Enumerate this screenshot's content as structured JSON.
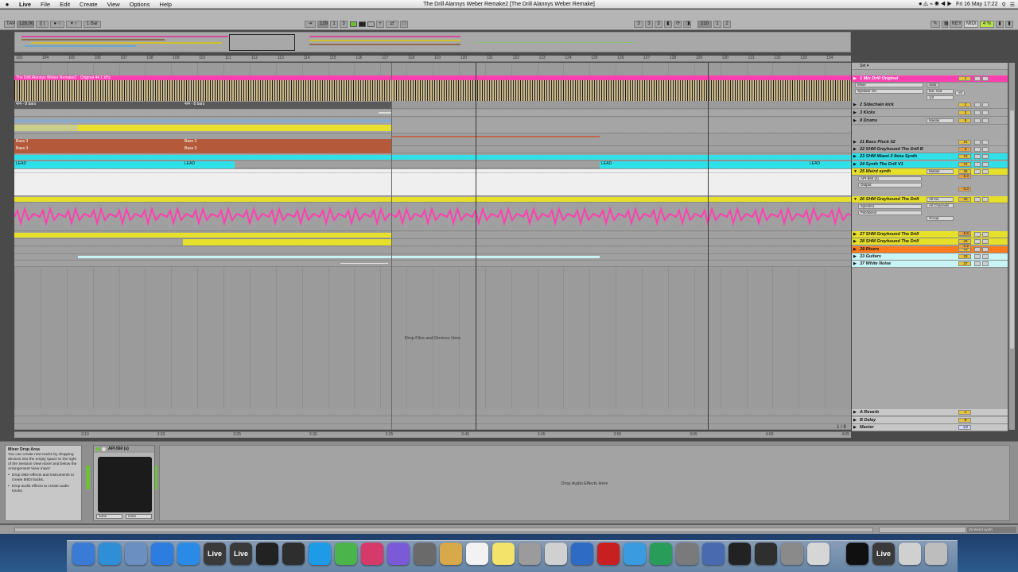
{
  "menubar": {
    "apple": "",
    "items": [
      "Live",
      "File",
      "Edit",
      "Create",
      "View",
      "Options",
      "Help"
    ],
    "window_title": "The Drill Alannys Weber Remake2  [The Drill Alannys Weber Remake]",
    "clock": "Fri 16 May  17:22"
  },
  "control_bar": {
    "tap": "TAP",
    "tempo": "128.00",
    "quantize": "1 Bar",
    "position": "129",
    "pos_beat": "1",
    "pos_sixteenth": "3",
    "loop_start": [
      "3",
      "3",
      "3"
    ],
    "loop_length": [
      "210",
      "1",
      "2"
    ],
    "key": "KEY",
    "midi": "MIDI",
    "cpu": "4 %"
  },
  "ruler": {
    "bars": [
      "103",
      "104",
      "105",
      "106",
      "107",
      "108",
      "109",
      "110",
      "111",
      "112",
      "113",
      "114",
      "115",
      "116",
      "117",
      "118",
      "119",
      "120",
      "121",
      "122",
      "123",
      "124",
      "125",
      "126",
      "127",
      "128",
      "129",
      "130",
      "131",
      "132",
      "133",
      "134"
    ]
  },
  "clips": {
    "audio_header": "The Drill Alannys Weber Remake2 · Original 44.1 kHz",
    "loop_a": "4/4 - 8 bars",
    "loop_b": "4/4 - 8 bars",
    "bass_a": "Bass 3",
    "bass_b": "Bass 3",
    "bass_c": "Bass 3",
    "bass_d": "Bass 3",
    "lead_a": "LEAD",
    "lead_b": "LEAD",
    "lead_c": "LEAD",
    "lead_d": "LEAD"
  },
  "drop_files": "Drop Files and Devices Here",
  "tracks": [
    {
      "name": "1 Mix Drill Original",
      "color": "#ff3fb0"
    },
    {
      "name": "2 Sidechain kick",
      "color": "#a9a9a9"
    },
    {
      "name": "3 Kicks",
      "color": "#a9a9a9"
    },
    {
      "name": "8 Drums",
      "color": "#a9a9a9"
    },
    {
      "name": "21 Bass Pluck 02",
      "color": "#a9a9a9"
    },
    {
      "name": "22 SHM Greyhound The Drill B",
      "color": "#a9a9a9"
    },
    {
      "name": "23 SHM Miami 2 Ibiza Synth",
      "color": "#2fe0e8"
    },
    {
      "name": "24 Synth The Drill V1",
      "color": "#2fe0e8"
    },
    {
      "name": "25 Weird synth",
      "color": "#e6e02a"
    },
    {
      "name": "26 SHM Greyhound The Drill",
      "color": "#e6e02a"
    },
    {
      "name": "27 SHM Greyhound The Drill",
      "color": "#e6e02a"
    },
    {
      "name": "28 SHM Greyhound The Drill",
      "color": "#e6e02a"
    },
    {
      "name": "29 Risers",
      "color": "#ff7a1a"
    },
    {
      "name": "33 Guitars",
      "color": "#c8f4f6"
    },
    {
      "name": "37 White Noise",
      "color": "#c8f4f6"
    }
  ],
  "io": {
    "mix_in_type": "Mixer",
    "mix_in_chan": "Speaker On",
    "mix_out": "Ext. Out",
    "mix_out_ch": "1/2",
    "auto": "Auto",
    "in": "In",
    "off": "Off",
    "drums_out": "Master",
    "weird_out": "Master",
    "weird_device": "API-560 (s)",
    "weird_param": "Output",
    "g26_in": "All Ins",
    "g26_ch": "All Channels",
    "g26_out": "Group",
    "g26_dev1": "Sylenth1",
    "g26_dev2": "Pitchbend",
    "inf": "-inf"
  },
  "track_numbers": [
    "1",
    "2",
    "3",
    "8",
    "21",
    "22",
    "23",
    "24",
    "25",
    "26",
    "27",
    "28",
    "29",
    "33",
    "37"
  ],
  "vol_values": [
    "0",
    "-6.3",
    "-3.3",
    "-5.8",
    "-2.2"
  ],
  "returns": [
    {
      "name": "A Reverb",
      "num": "A"
    },
    {
      "name": "B Delay",
      "num": "B"
    },
    {
      "name": "Master",
      "num": "1/2"
    }
  ],
  "page_indicator": "1 / 8",
  "timebar_labels": [
    "3:10",
    "3:20",
    "3:25",
    "3:30",
    "3:35",
    "3:40",
    "3:45",
    "3:50",
    "3:55",
    "4:00",
    "4:05"
  ],
  "info_view": {
    "title": "Mixer Drop Area",
    "body": "You can create new tracks by dropping devices into the empty space to the right of the Session View mixer and below the Arrangement View mixer:",
    "bullet1": "Drop MIDI effects and instruments to create MIDI tracks.",
    "bullet2": "Drop audio effects to create audio tracks."
  },
  "device": {
    "title": "API-560 (s)",
    "sel_a": "none",
    "sel_b": "none"
  },
  "drop_audio": "Drop Audio Effects Here",
  "status": "25 Weird synth",
  "dock": {
    "icons": [
      "finder-icon",
      "safari-icon",
      "preview-icon",
      "itunes-icon",
      "appstore-icon",
      "live-icon",
      "live2-icon",
      "unity-icon",
      "ableton-push-icon",
      "wunderlist-icon",
      "maps-icon",
      "pinterest-icon",
      "finder2-icon",
      "rocket-icon",
      "notes-icon",
      "calendar-icon",
      "stickies-icon",
      "photos-icon",
      "screenshot-icon",
      "quicktime-icon",
      "acrobat-icon",
      "messages-icon",
      "downloader-icon",
      "vmware-icon",
      "xcode-icon",
      "ilok-icon",
      "activity-icon",
      "sysprefs-icon",
      "calculator-icon",
      "magnet-icon",
      "live3-icon",
      "screen-icon",
      "trash-icon"
    ],
    "live_label": "Live"
  },
  "colors": {
    "pink": "#ff3fb0",
    "cyan": "#2fe0e8",
    "yellow": "#e6e02a",
    "bass_brown": "#b45a3a",
    "orange": "#ff7a1a"
  }
}
